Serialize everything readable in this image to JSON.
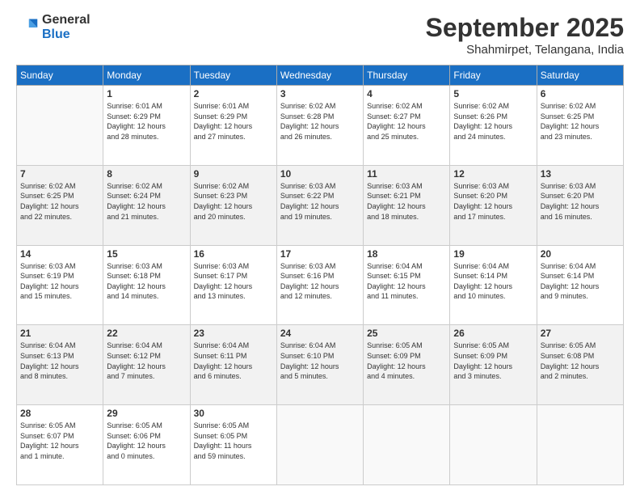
{
  "logo": {
    "line1": "General",
    "line2": "Blue"
  },
  "title": "September 2025",
  "subtitle": "Shahmirpet, Telangana, India",
  "headers": [
    "Sunday",
    "Monday",
    "Tuesday",
    "Wednesday",
    "Thursday",
    "Friday",
    "Saturday"
  ],
  "weeks": [
    [
      {
        "day": "",
        "info": ""
      },
      {
        "day": "1",
        "info": "Sunrise: 6:01 AM\nSunset: 6:29 PM\nDaylight: 12 hours\nand 28 minutes."
      },
      {
        "day": "2",
        "info": "Sunrise: 6:01 AM\nSunset: 6:29 PM\nDaylight: 12 hours\nand 27 minutes."
      },
      {
        "day": "3",
        "info": "Sunrise: 6:02 AM\nSunset: 6:28 PM\nDaylight: 12 hours\nand 26 minutes."
      },
      {
        "day": "4",
        "info": "Sunrise: 6:02 AM\nSunset: 6:27 PM\nDaylight: 12 hours\nand 25 minutes."
      },
      {
        "day": "5",
        "info": "Sunrise: 6:02 AM\nSunset: 6:26 PM\nDaylight: 12 hours\nand 24 minutes."
      },
      {
        "day": "6",
        "info": "Sunrise: 6:02 AM\nSunset: 6:25 PM\nDaylight: 12 hours\nand 23 minutes."
      }
    ],
    [
      {
        "day": "7",
        "info": "Sunrise: 6:02 AM\nSunset: 6:25 PM\nDaylight: 12 hours\nand 22 minutes."
      },
      {
        "day": "8",
        "info": "Sunrise: 6:02 AM\nSunset: 6:24 PM\nDaylight: 12 hours\nand 21 minutes."
      },
      {
        "day": "9",
        "info": "Sunrise: 6:02 AM\nSunset: 6:23 PM\nDaylight: 12 hours\nand 20 minutes."
      },
      {
        "day": "10",
        "info": "Sunrise: 6:03 AM\nSunset: 6:22 PM\nDaylight: 12 hours\nand 19 minutes."
      },
      {
        "day": "11",
        "info": "Sunrise: 6:03 AM\nSunset: 6:21 PM\nDaylight: 12 hours\nand 18 minutes."
      },
      {
        "day": "12",
        "info": "Sunrise: 6:03 AM\nSunset: 6:20 PM\nDaylight: 12 hours\nand 17 minutes."
      },
      {
        "day": "13",
        "info": "Sunrise: 6:03 AM\nSunset: 6:20 PM\nDaylight: 12 hours\nand 16 minutes."
      }
    ],
    [
      {
        "day": "14",
        "info": "Sunrise: 6:03 AM\nSunset: 6:19 PM\nDaylight: 12 hours\nand 15 minutes."
      },
      {
        "day": "15",
        "info": "Sunrise: 6:03 AM\nSunset: 6:18 PM\nDaylight: 12 hours\nand 14 minutes."
      },
      {
        "day": "16",
        "info": "Sunrise: 6:03 AM\nSunset: 6:17 PM\nDaylight: 12 hours\nand 13 minutes."
      },
      {
        "day": "17",
        "info": "Sunrise: 6:03 AM\nSunset: 6:16 PM\nDaylight: 12 hours\nand 12 minutes."
      },
      {
        "day": "18",
        "info": "Sunrise: 6:04 AM\nSunset: 6:15 PM\nDaylight: 12 hours\nand 11 minutes."
      },
      {
        "day": "19",
        "info": "Sunrise: 6:04 AM\nSunset: 6:14 PM\nDaylight: 12 hours\nand 10 minutes."
      },
      {
        "day": "20",
        "info": "Sunrise: 6:04 AM\nSunset: 6:14 PM\nDaylight: 12 hours\nand 9 minutes."
      }
    ],
    [
      {
        "day": "21",
        "info": "Sunrise: 6:04 AM\nSunset: 6:13 PM\nDaylight: 12 hours\nand 8 minutes."
      },
      {
        "day": "22",
        "info": "Sunrise: 6:04 AM\nSunset: 6:12 PM\nDaylight: 12 hours\nand 7 minutes."
      },
      {
        "day": "23",
        "info": "Sunrise: 6:04 AM\nSunset: 6:11 PM\nDaylight: 12 hours\nand 6 minutes."
      },
      {
        "day": "24",
        "info": "Sunrise: 6:04 AM\nSunset: 6:10 PM\nDaylight: 12 hours\nand 5 minutes."
      },
      {
        "day": "25",
        "info": "Sunrise: 6:05 AM\nSunset: 6:09 PM\nDaylight: 12 hours\nand 4 minutes."
      },
      {
        "day": "26",
        "info": "Sunrise: 6:05 AM\nSunset: 6:09 PM\nDaylight: 12 hours\nand 3 minutes."
      },
      {
        "day": "27",
        "info": "Sunrise: 6:05 AM\nSunset: 6:08 PM\nDaylight: 12 hours\nand 2 minutes."
      }
    ],
    [
      {
        "day": "28",
        "info": "Sunrise: 6:05 AM\nSunset: 6:07 PM\nDaylight: 12 hours\nand 1 minute."
      },
      {
        "day": "29",
        "info": "Sunrise: 6:05 AM\nSunset: 6:06 PM\nDaylight: 12 hours\nand 0 minutes."
      },
      {
        "day": "30",
        "info": "Sunrise: 6:05 AM\nSunset: 6:05 PM\nDaylight: 11 hours\nand 59 minutes."
      },
      {
        "day": "",
        "info": ""
      },
      {
        "day": "",
        "info": ""
      },
      {
        "day": "",
        "info": ""
      },
      {
        "day": "",
        "info": ""
      }
    ]
  ]
}
